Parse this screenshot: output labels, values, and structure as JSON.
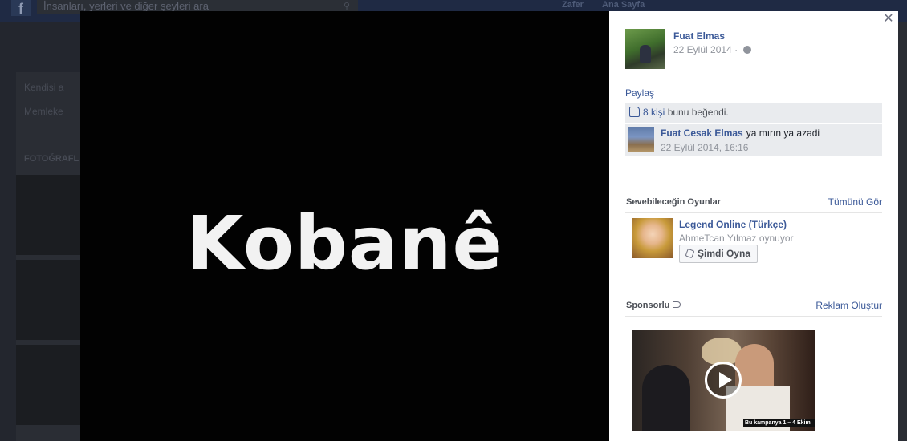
{
  "background": {
    "search_placeholder": "İnsanları, yerleri ve diğer şeyleri ara",
    "nav_items": [
      "Zafer",
      "Ana Sayfa"
    ],
    "left_items": [
      "Kendisi a",
      "Memleke"
    ],
    "photos_heading": "FOTOĞRAFL"
  },
  "viewer": {
    "photo_text": "Kobanê"
  },
  "post": {
    "author": "Fuat Elmas",
    "date": "22 Eylül 2014",
    "date_separator": "·",
    "share_label": "Paylaş",
    "likes_count": "8 kişi",
    "likes_suffix": "bunu beğendi.",
    "comment": {
      "author": "Fuat Cesak Elmas",
      "text": "ya mırın ya azadi",
      "time": "22 Eylül 2014, 16:16"
    }
  },
  "games": {
    "heading": "Sevebileceğin Oyunlar",
    "see_all": "Tümünü Gör",
    "game_title": "Legend Online (Türkçe)",
    "game_sub": "AhmeTcan Yılmaz oynuyor",
    "play_label": "Şimdi Oyna"
  },
  "sponsored": {
    "heading": "Sponsorlu",
    "create_ad": "Reklam Oluştur",
    "video_caption": "Bu kampanya 1 – 4 Ekim"
  },
  "colors": {
    "link": "#3b5998",
    "stage": "#020202",
    "panel": "#ffffff"
  }
}
